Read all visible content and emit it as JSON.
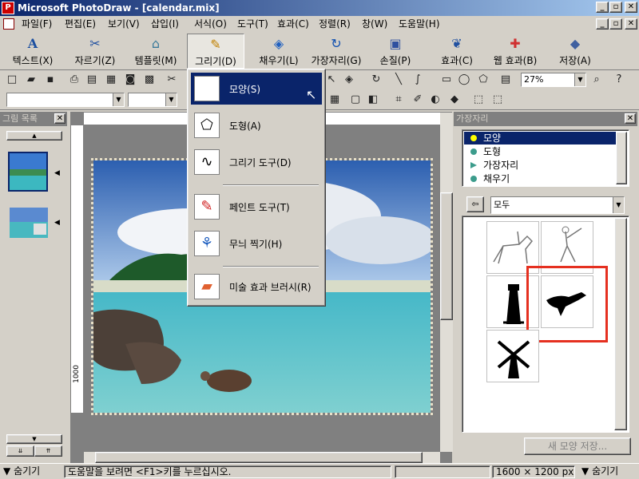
{
  "window": {
    "title": "Microsoft PhotoDraw - [calendar.mix]",
    "controls": [
      "_",
      "▫",
      "✕"
    ]
  },
  "menu": {
    "items": [
      "파일(F)",
      "편집(E)",
      "보기(V)",
      "삽입(I)",
      "서식(O)",
      "도구(T)",
      "효과(C)",
      "정렬(R)",
      "창(W)",
      "도움말(H)"
    ]
  },
  "bigtoolbar": {
    "buttons": [
      {
        "label": "텍스트(X)",
        "icon": "text-A-icon"
      },
      {
        "label": "자르기(Z)",
        "icon": "scissors-icon"
      },
      {
        "label": "템플릿(M)",
        "icon": "template-folder-icon"
      },
      {
        "label": "그리기(D)",
        "icon": "pencil-draw-icon"
      },
      {
        "label": "채우기(L)",
        "icon": "paint-bucket-icon"
      },
      {
        "label": "가장자리(G)",
        "icon": "edge-brush-icon"
      },
      {
        "label": "손질(P)",
        "icon": "touchup-icon"
      },
      {
        "label": "효과(C)",
        "icon": "effects-icon"
      },
      {
        "label": "웹 효과(B)",
        "icon": "web-effects-icon"
      },
      {
        "label": "저장(A)",
        "icon": "save-wizard-icon"
      }
    ]
  },
  "stdtoolbar": {
    "zoom": "27%"
  },
  "draw_menu": {
    "items": [
      {
        "label": "모양(S)",
        "icon": "shape-icon",
        "selected": true
      },
      {
        "label": "도형(A)",
        "icon": "autoshape-icon",
        "selected": false
      },
      {
        "label": "그리기 도구(D)",
        "icon": "draw-tools-icon",
        "selected": false
      },
      {
        "label": "페인트 도구(T)",
        "icon": "paint-tools-icon",
        "selected": false
      },
      {
        "label": "무늬 찍기(H)",
        "icon": "stamp-pattern-icon",
        "selected": false
      },
      {
        "label": "미술 효과 브러시(R)",
        "icon": "art-brush-icon",
        "selected": false
      }
    ]
  },
  "left_panel": {
    "title": "그림 목록",
    "thumbnails": [
      "beach-photo",
      "calendar-photo"
    ]
  },
  "canvas": {
    "ruler_label": "1000"
  },
  "right_panel": {
    "title": "가장자리",
    "categories": [
      {
        "label": "모양",
        "color": "#ffff00"
      },
      {
        "label": "도형",
        "color": "#3c9c8c"
      },
      {
        "label": "가장자리",
        "color": "#3c9c8c"
      },
      {
        "label": "채우기",
        "color": "#3c9c8c"
      }
    ],
    "filter": "모두",
    "save_button": "새 모양 저장..."
  },
  "status": {
    "hide_left": "숨기기",
    "hint": "도움말을 보려면 <F1>키를 누르십시오.",
    "dimensions": "1600 × 1200  px",
    "hide_right": "숨기기"
  },
  "colors": {
    "selection": "#0a246a",
    "highlight_box": "#e53020"
  }
}
